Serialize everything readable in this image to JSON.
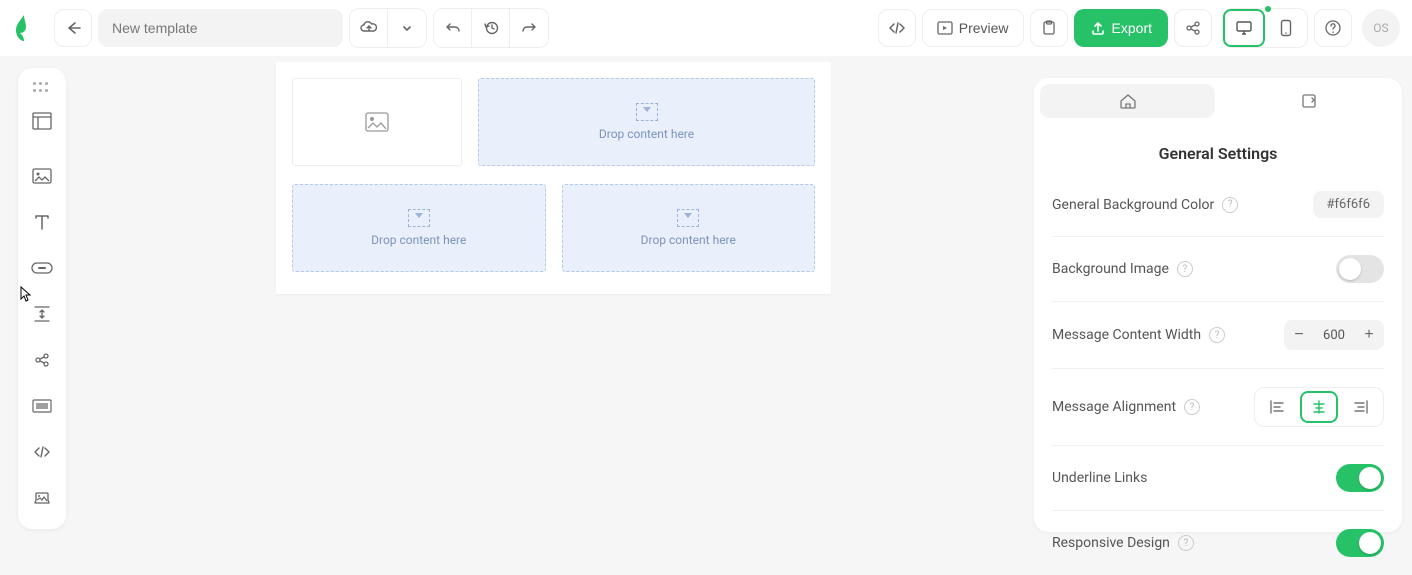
{
  "header": {
    "template_name": "New template",
    "preview_label": "Preview",
    "export_label": "Export",
    "avatar_initials": "OS"
  },
  "canvas": {
    "drop_label": "Drop content here"
  },
  "settings": {
    "panel_title": "General Settings",
    "items": {
      "bg_color": {
        "label": "General Background Color",
        "value": "#f6f6f6"
      },
      "bg_image": {
        "label": "Background Image",
        "enabled": false
      },
      "content_width": {
        "label": "Message Content Width",
        "value": "600"
      },
      "alignment": {
        "label": "Message Alignment",
        "value": "center"
      },
      "underline_links": {
        "label": "Underline Links",
        "enabled": true
      },
      "responsive": {
        "label": "Responsive Design",
        "enabled": true
      }
    }
  }
}
